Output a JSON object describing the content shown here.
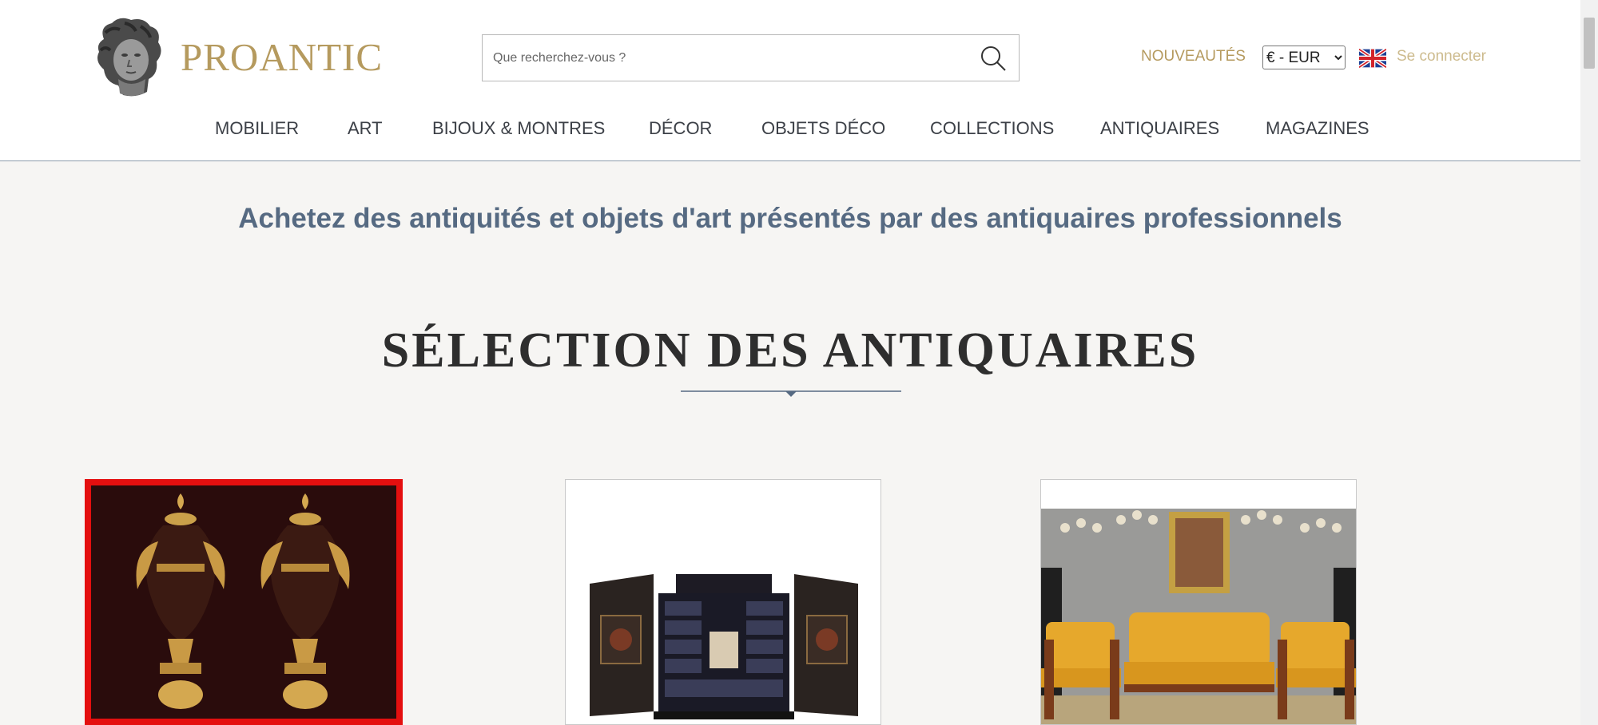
{
  "brand": {
    "name": "PROANTIC"
  },
  "search": {
    "placeholder": "Que recherchez-vous ?",
    "value": ""
  },
  "header": {
    "new_label": "NOUVEAUTÉS",
    "currency_selected": "€ - EUR",
    "login_label": "Se connecter"
  },
  "nav": {
    "items": [
      {
        "label": "MOBILIER"
      },
      {
        "label": "ART"
      },
      {
        "label": "BIJOUX & MONTRES"
      },
      {
        "label": "DÉCOR"
      },
      {
        "label": "OBJETS DÉCO"
      },
      {
        "label": "COLLECTIONS"
      },
      {
        "label": "ANTIQUAIRES"
      },
      {
        "label": "MAGAZINES"
      }
    ]
  },
  "main": {
    "tagline": "Achetez des antiquités et objets d'art présentés par des antiquaires professionnels",
    "section_title": "SÉLECTION DES ANTIQUAIRES",
    "cards": [
      {
        "image": "pair-of-bronze-vases"
      },
      {
        "image": "ebony-cabinet"
      },
      {
        "image": "empire-salon-set"
      }
    ]
  },
  "colors": {
    "gold": "#b59a5e",
    "tagline": "#566a82",
    "selection_border": "#e40f0f",
    "header_border": "#8c9bab"
  }
}
